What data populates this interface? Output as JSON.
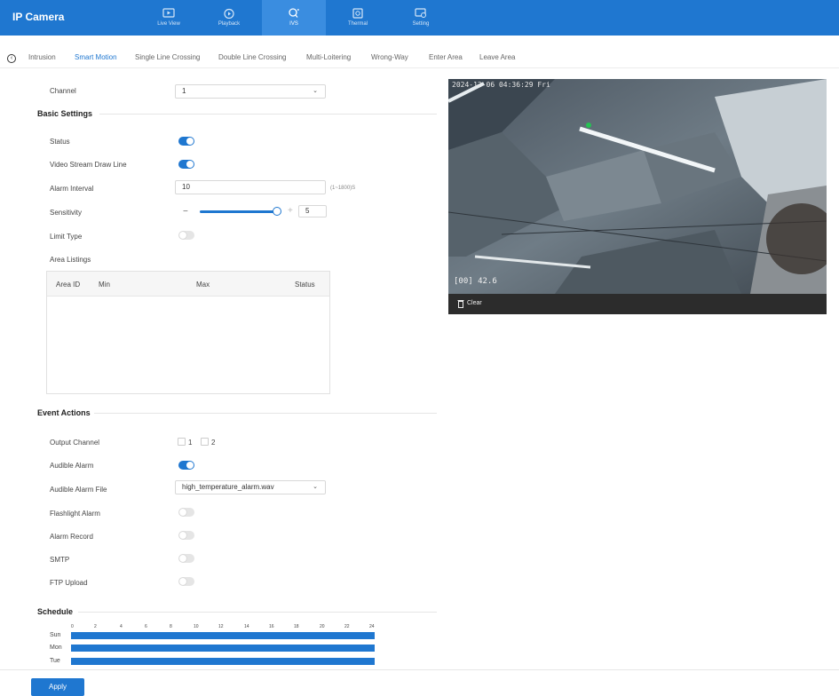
{
  "app": {
    "title": "IP Camera"
  },
  "nav": [
    {
      "label": "Live View",
      "icon": "live-view-icon"
    },
    {
      "label": "Playback",
      "icon": "playback-icon"
    },
    {
      "label": "IVS",
      "icon": "ivs-icon"
    },
    {
      "label": "Thermal",
      "icon": "thermal-icon"
    },
    {
      "label": "Setting",
      "icon": "setting-icon"
    }
  ],
  "tabs": [
    "Intrusion",
    "Smart Motion",
    "Single Line Crossing",
    "Double Line Crossing",
    "Multi-Loitering",
    "Wrong-Way",
    "Enter Area",
    "Leave Area"
  ],
  "active_tab": "Smart Motion",
  "form": {
    "channel_label": "Channel",
    "channel_value": "1",
    "basic_settings": "Basic Settings",
    "status_label": "Status",
    "status_on": true,
    "draw_line_label": "Video Stream Draw Line",
    "draw_line_on": true,
    "alarm_interval_label": "Alarm Interval",
    "alarm_interval_value": "10",
    "alarm_interval_hint": "(1~1800)S",
    "sensitivity_label": "Sensitivity",
    "sensitivity_value": "5",
    "sensitivity_minus": "−",
    "sensitivity_plus": "+",
    "limit_type_label": "Limit Type",
    "limit_type_on": false,
    "area_listings_label": "Area Listings",
    "table_headers": [
      "Area ID",
      "Min",
      "Max",
      "Status"
    ]
  },
  "event_actions": {
    "title": "Event Actions",
    "output_channel_label": "Output Channel",
    "output_channels": [
      "1",
      "2"
    ],
    "audible_alarm_label": "Audible Alarm",
    "audible_alarm_on": true,
    "audible_alarm_file_label": "Audible Alarm File",
    "audible_alarm_file_value": "high_temperature_alarm.wav",
    "flashlight_alarm_label": "Flashlight Alarm",
    "alarm_record_label": "Alarm Record",
    "smtp_label": "SMTP",
    "ftp_upload_label": "FTP Upload"
  },
  "schedule": {
    "title": "Schedule",
    "hours": [
      "0",
      "2",
      "4",
      "6",
      "8",
      "10",
      "12",
      "14",
      "16",
      "18",
      "20",
      "22",
      "24"
    ],
    "days": [
      "Sun",
      "Mon",
      "Tue"
    ]
  },
  "preview": {
    "timestamp": "2024-12-06 04:36:29 Fri",
    "overlay_text": "[00] 42.6",
    "clear_label": "Clear"
  },
  "footer": {
    "apply_label": "Apply"
  },
  "colors": {
    "accent": "#1f77d0",
    "topbar": "#1f77d0"
  }
}
